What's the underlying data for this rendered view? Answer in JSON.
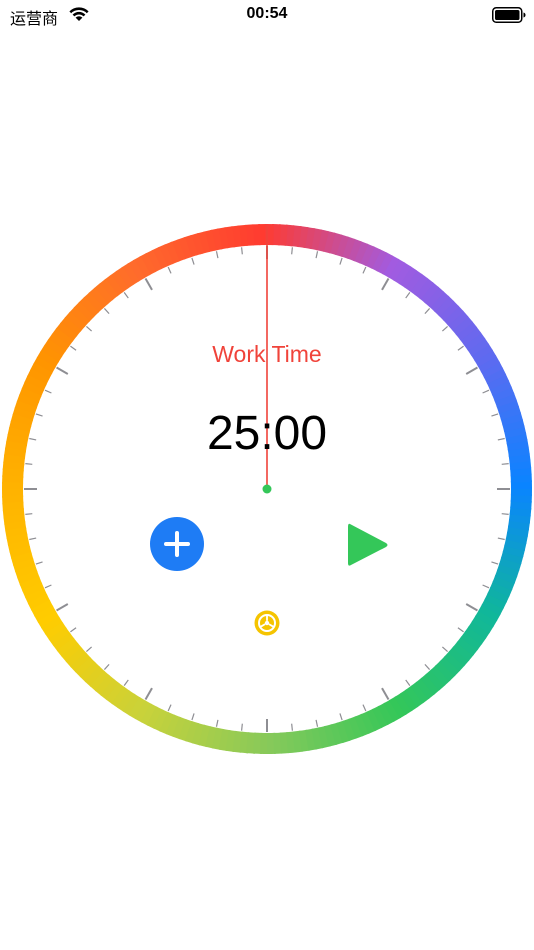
{
  "status_bar": {
    "carrier": "运营商",
    "time": "00:54",
    "wifi_icon": "wifi-icon",
    "battery_icon": "battery-icon"
  },
  "timer": {
    "mode_label": "Work Time",
    "time_value": "25:00",
    "hand_position_fraction": 0.0
  },
  "controls": {
    "add_icon": "plus-icon",
    "play_icon": "play-icon",
    "settings_icon": "gear-icon"
  },
  "colors": {
    "mode_label": "#f0433a",
    "hand": "#f0433a",
    "center_dot": "#34c759",
    "add_button": "#1e7cf5",
    "play_button": "#34c759",
    "settings_button": "#f5c400",
    "tick_marks": "#8e8e93",
    "ring_gradient": [
      "#ff3b30",
      "#ff6b2c",
      "#ff9500",
      "#ffb300",
      "#ffcc00",
      "#c9d23a",
      "#86c95a",
      "#34c759",
      "#10b79a",
      "#0a84ff",
      "#5e6af0",
      "#a25be0"
    ]
  }
}
